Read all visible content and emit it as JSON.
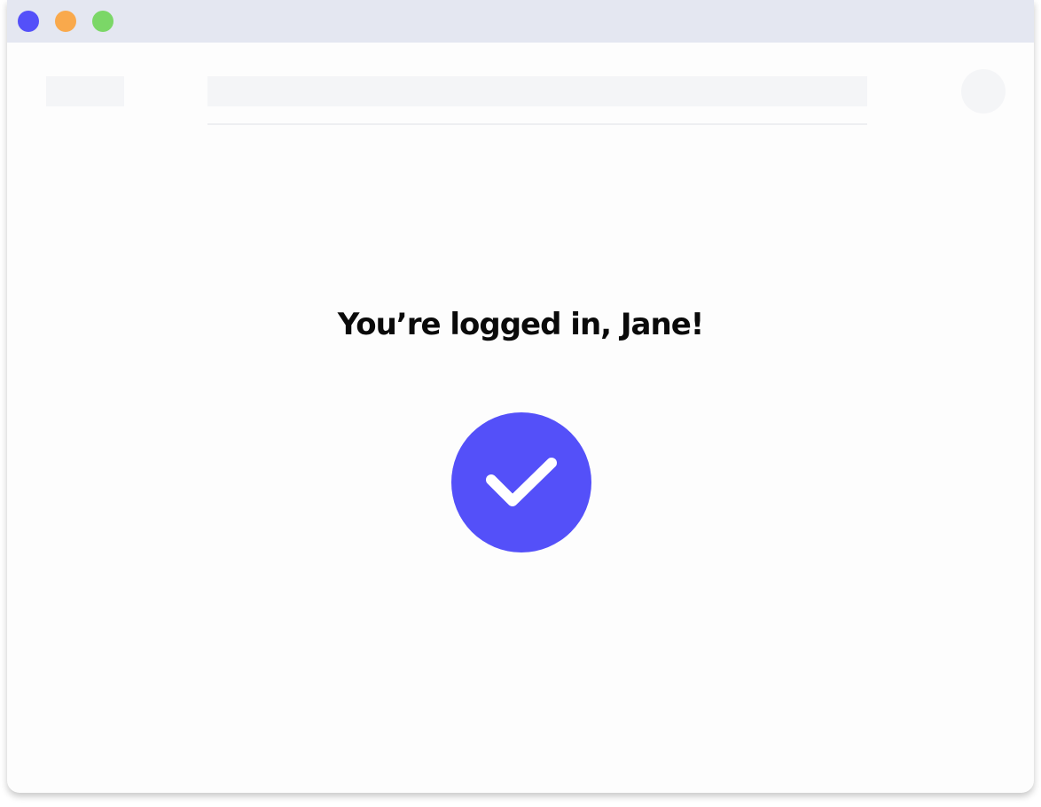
{
  "window": {
    "controls": [
      {
        "name": "close",
        "color": "#5450f9"
      },
      {
        "name": "minimize",
        "color": "#f9a94c"
      },
      {
        "name": "zoom",
        "color": "#7bd767"
      }
    ]
  },
  "header": {
    "logo_placeholder": "",
    "search_placeholder": "",
    "avatar_placeholder": ""
  },
  "main": {
    "message": "You’re logged in, Jane!",
    "status_icon": "checkmark-circle-icon"
  },
  "colors": {
    "accent": "#5450f9",
    "placeholder": "#f4f5f7",
    "titlebar": "#e4e7f1"
  }
}
